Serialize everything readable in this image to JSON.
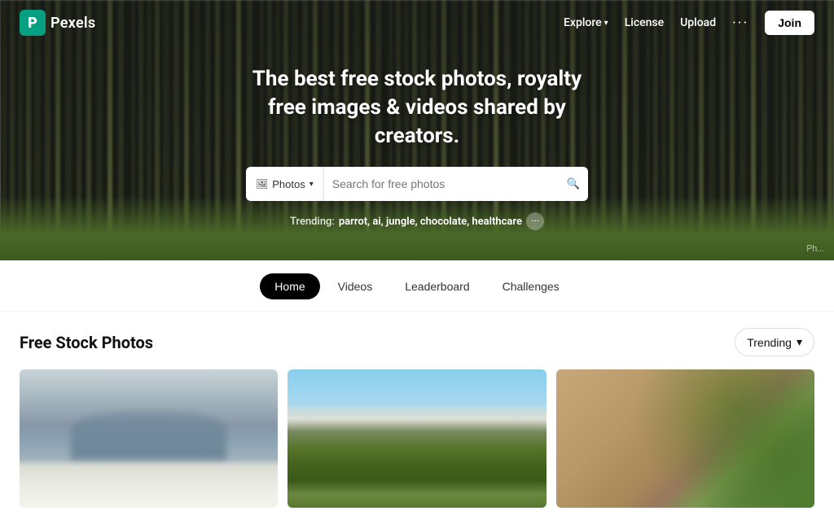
{
  "brand": {
    "logo_letter": "P",
    "name": "Pexels"
  },
  "navbar": {
    "explore_label": "Explore",
    "license_label": "License",
    "upload_label": "Upload",
    "more_label": "···",
    "join_label": "Join"
  },
  "hero": {
    "title": "The best free stock photos, royalty free images & videos shared by creators.",
    "search_type": "Photos",
    "search_placeholder": "Search for free photos",
    "trending_label": "Trending:",
    "trending_terms": "parrot, ai, jungle, chocolate, healthcare",
    "photo_credit": "Ph..."
  },
  "tabs": [
    {
      "id": "home",
      "label": "Home",
      "active": true
    },
    {
      "id": "videos",
      "label": "Videos",
      "active": false
    },
    {
      "id": "leaderboard",
      "label": "Leaderboard",
      "active": false
    },
    {
      "id": "challenges",
      "label": "Challenges",
      "active": false
    }
  ],
  "content": {
    "section_title": "Free Stock Photos",
    "sort_label": "Trending"
  }
}
